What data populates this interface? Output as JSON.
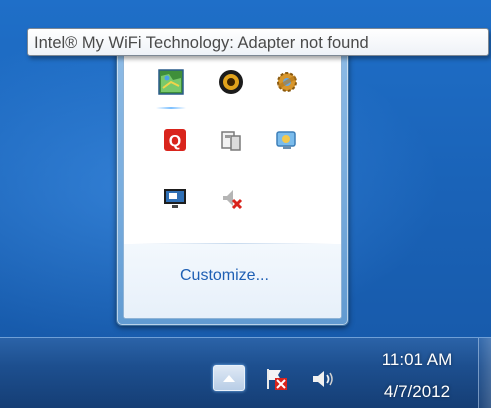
{
  "tooltip": {
    "text": "Intel® My WiFi Technology: Adapter not found"
  },
  "flyout": {
    "icons": [
      {
        "name": "network-map-icon",
        "selected": true
      },
      {
        "name": "media-player-icon"
      },
      {
        "name": "settings-gear-icon"
      },
      {
        "name": "q-app-icon"
      },
      {
        "name": "removable-device-icon"
      },
      {
        "name": "display-settings-icon"
      },
      {
        "name": "monitor-remote-icon"
      },
      {
        "name": "wireless-disabled-icon"
      }
    ],
    "customize_label": "Customize..."
  },
  "taskbar": {
    "time": "11:01 AM",
    "date": "4/7/2012"
  },
  "colors": {
    "desktop": "#1a63b8",
    "taskbar": "#1d4f8f",
    "link": "#1e5fb4",
    "alert_red": "#d9241c"
  }
}
